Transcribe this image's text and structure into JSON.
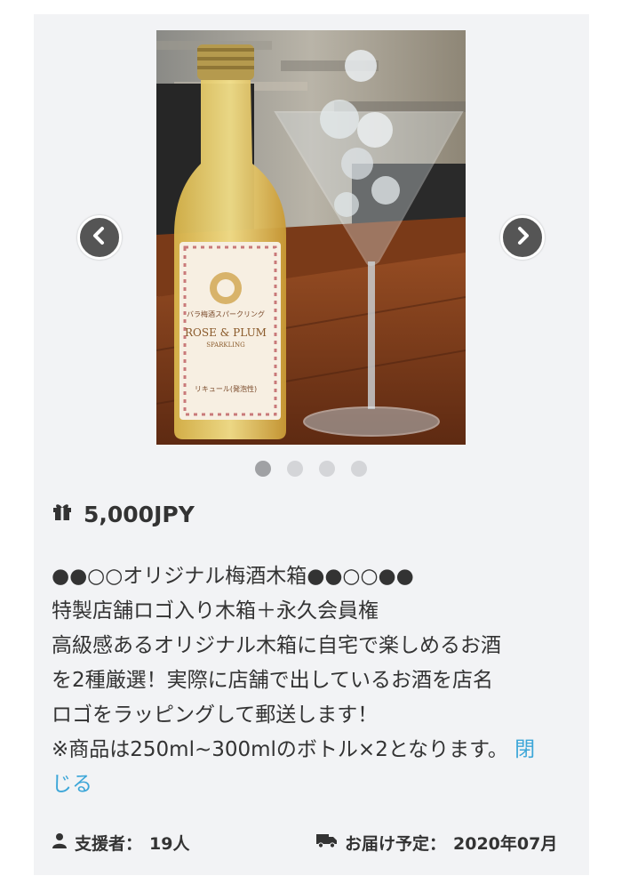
{
  "carousel": {
    "prev_icon": "chevron-left-icon",
    "next_icon": "chevron-right-icon",
    "slide_count": 4,
    "active_index": 0,
    "label_line1": "バラ梅酒スパークリング",
    "label_line2": "ROSE & PLUM",
    "label_line3": "SPARKLING",
    "label_line4": "リキュール(発泡性)"
  },
  "reward": {
    "price_icon": "gift-icon",
    "price": "5,000JPY",
    "lines": [
      "●●○○オリジナル梅酒木箱●●○○●●",
      "特製店舗ロゴ入り木箱＋永久会員権",
      "高級感あるオリジナル木箱に自宅で楽しめるお酒",
      "を2種厳選！実際に店舗で出しているお酒を店名",
      "ロゴをラッピングして郵送します！"
    ],
    "last_line": "※商品は250ml~300mlのボトル×2となります。",
    "close_part1": "閉",
    "close_part2": "じる",
    "backers_icon": "user-icon",
    "backers_label": "支援者：",
    "backers_count": "19人",
    "delivery_icon": "truck-icon",
    "delivery_label": "お届け予定：",
    "delivery_date": "2020年07月"
  },
  "colors": {
    "card_bg": "#f2f3f5",
    "link": "#3ca6d8",
    "arrow_bg": "#555555",
    "dot_active": "#a0a1a4",
    "dot_inactive": "#d4d5d8"
  }
}
